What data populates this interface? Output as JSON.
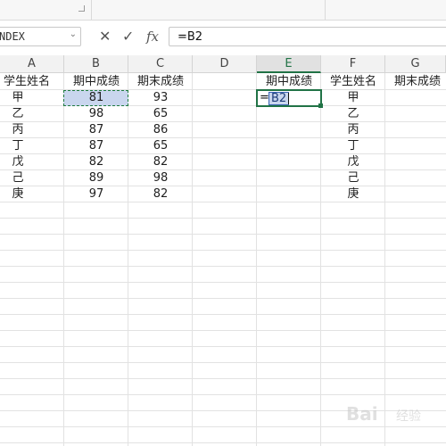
{
  "formula_bar": {
    "name_box": "NDEX",
    "name_box_caret": "⌄",
    "cancel_glyph": "✕",
    "enter_glyph": "✓",
    "fx_label": "fx",
    "formula": "=B2"
  },
  "columns": [
    "A",
    "B",
    "C",
    "D",
    "E",
    "F",
    "G"
  ],
  "active_column": "E",
  "headers": {
    "A": "学生姓名",
    "B": "期中成绩",
    "C": "期末成绩",
    "E": "期中成绩",
    "F": "学生姓名",
    "G": "期末成绩"
  },
  "table_left": {
    "rows": [
      {
        "name": "甲",
        "mid": "81",
        "final": "93"
      },
      {
        "name": "乙",
        "mid": "98",
        "final": "65"
      },
      {
        "name": "丙",
        "mid": "87",
        "final": "86"
      },
      {
        "name": "丁",
        "mid": "87",
        "final": "65"
      },
      {
        "name": "戊",
        "mid": "82",
        "final": "82"
      },
      {
        "name": "己",
        "mid": "89",
        "final": "98"
      },
      {
        "name": "庚",
        "mid": "97",
        "final": "82"
      }
    ]
  },
  "table_right_names": [
    "甲",
    "乙",
    "丙",
    "丁",
    "戊",
    "己",
    "庚"
  ],
  "editing_cell": {
    "equals": "=",
    "reference": "B2"
  },
  "colors": {
    "accent_green": "#217346",
    "selection_fill": "#c9d6ee",
    "reference_border": "#3b64b4"
  },
  "watermark": {
    "brand": "Bai",
    "suffix": "经验"
  }
}
